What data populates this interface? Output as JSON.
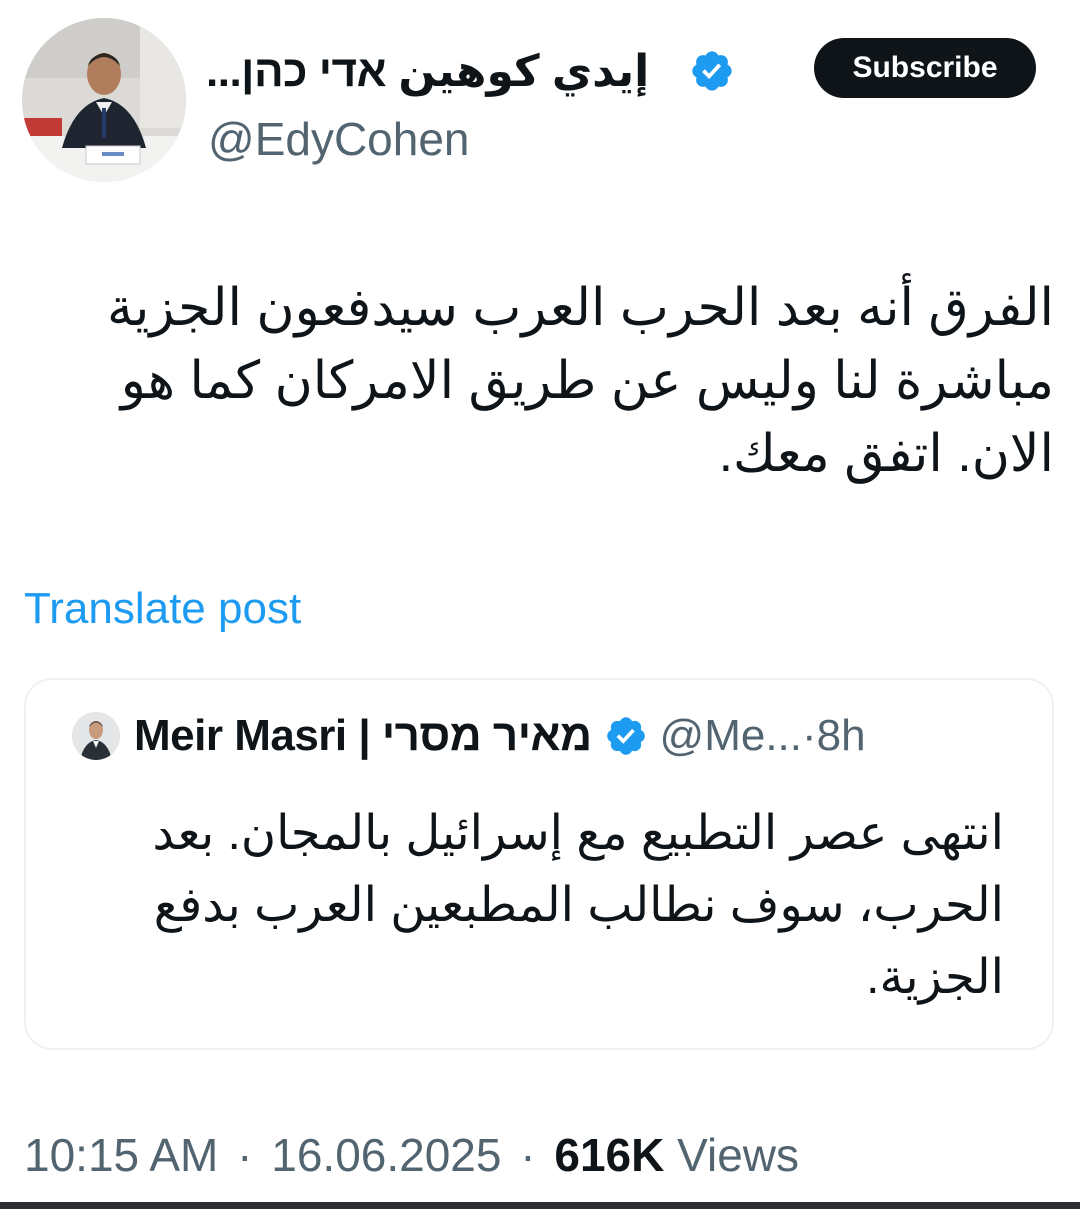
{
  "author": {
    "display_name": "إيدي كوهين אדי כהן...",
    "handle": "@EdyCohen",
    "verified": true
  },
  "subscribe_label": "Subscribe",
  "tweet": {
    "text": "الفرق أنه بعد الحرب العرب  سيدفعون الجزية مباشرة لنا وليس عن طريق الامركان كما هو الان. اتفق معك.",
    "translate_label": "Translate post"
  },
  "quote": {
    "name": "Meir Masri | מאיר מסרי",
    "handle": "@Me...",
    "separator": "·",
    "time": "8h",
    "text": "انتهى عصر التطبيع مع إسرائيل بالمجان. بعد الحرب، سوف نطالب المطبعين العرب بدفع الجزية."
  },
  "footer": {
    "time": "10:15 AM",
    "separator": "·",
    "date": "16.06.2025",
    "views_count": "616K",
    "views_label": "Views"
  },
  "colors": {
    "accent": "#1d9bf0",
    "text_primary": "#0f1419",
    "text_secondary": "#536471",
    "subscribe_bg": "#0f1419"
  },
  "icons": {
    "verified": "verified-badge-icon",
    "avatar": "profile-photo",
    "quote_avatar": "profile-photo"
  }
}
